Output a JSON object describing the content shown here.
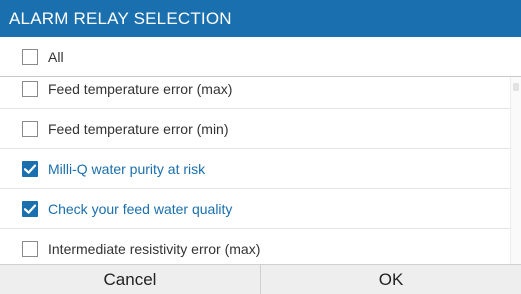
{
  "dialog": {
    "title": "ALARM RELAY SELECTION",
    "accent_color": "#1a6fae"
  },
  "select_all": {
    "label": "All",
    "checked": false
  },
  "items": [
    {
      "label": "Feed temperature error (max)",
      "checked": false
    },
    {
      "label": "Feed temperature error (min)",
      "checked": false
    },
    {
      "label": "Milli-Q water purity at risk",
      "checked": true
    },
    {
      "label": "Check your feed water quality",
      "checked": true
    },
    {
      "label": "Intermediate resistivity error (max)",
      "checked": false
    }
  ],
  "buttons": {
    "cancel_label": "Cancel",
    "ok_label": "OK"
  }
}
